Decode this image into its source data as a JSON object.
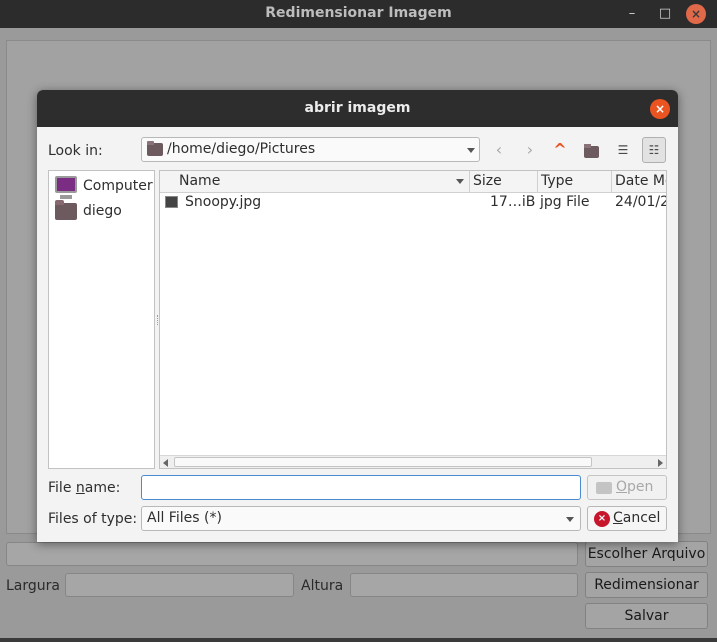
{
  "main_window": {
    "title": "Redimensionar Imagem",
    "controls": {
      "minimize": "–",
      "maximize": "□",
      "close": "×"
    },
    "choose_file_button": "Escolher Arquivo",
    "width_label": "Largura",
    "height_label": "Altura",
    "resize_button": "Redimensionar",
    "save_button": "Salvar"
  },
  "dialog": {
    "title": "abrir imagem",
    "close_glyph": "×",
    "look_in_label": "Look in:",
    "path": "/home/diego/Pictures",
    "nav": {
      "back": "‹",
      "forward": "›",
      "up": "^",
      "list_view": "☰",
      "detail_view": "☷"
    },
    "sidebar": {
      "items": [
        {
          "label": "Computer"
        },
        {
          "label": "diego"
        }
      ]
    },
    "columns": {
      "name": "Name",
      "size": "Size",
      "type": "Type",
      "date": "Date Mo"
    },
    "files": [
      {
        "name": "Snoopy.jpg",
        "size": "17…iB",
        "type": "jpg File",
        "date": "24/01/2"
      }
    ],
    "file_name_label_pre": "File ",
    "file_name_label_ul": "n",
    "file_name_label_post": "ame:",
    "file_name_value": "",
    "open_button_ul": "O",
    "open_button_rest": "pen",
    "files_of_type_label": "Files of type:",
    "files_of_type_value": "All Files (*)",
    "cancel_button_ul": "C",
    "cancel_button_rest": "ancel",
    "cancel_glyph": "×"
  }
}
